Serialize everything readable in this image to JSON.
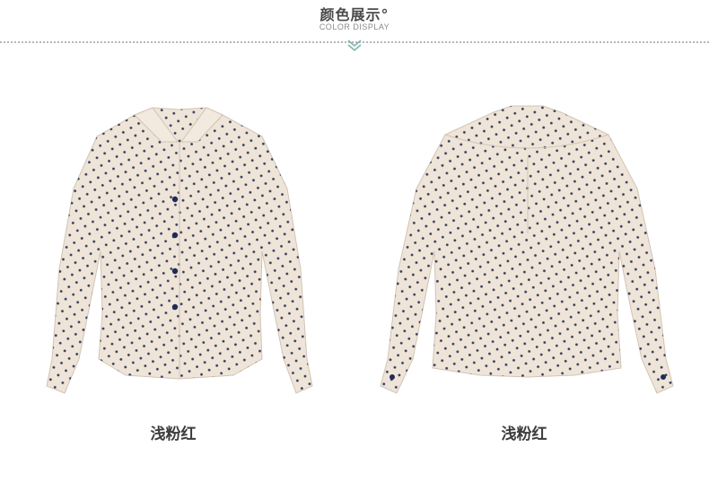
{
  "header": {
    "title": "颜色展示°",
    "subtitle": "COLOR DISPLAY"
  },
  "products": [
    {
      "view": "front",
      "caption": "浅粉红"
    },
    {
      "view": "back",
      "caption": "浅粉红"
    }
  ],
  "colors": {
    "fabric": "#efe4d8",
    "dot": "#1d2a4d",
    "button": "#1f2b55",
    "accent": "#7fb3b0"
  },
  "icons": [
    "chevron-down-icon"
  ]
}
